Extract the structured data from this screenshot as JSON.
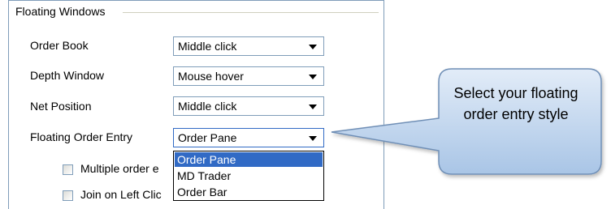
{
  "group": {
    "title": "Floating Windows"
  },
  "rows": [
    {
      "label": "Order Book",
      "value": "Middle click"
    },
    {
      "label": "Depth Window",
      "value": "Mouse hover"
    },
    {
      "label": "Net Position",
      "value": "Middle click"
    },
    {
      "label": "Floating Order Entry",
      "value": "Order Pane"
    }
  ],
  "dropdown": {
    "options": [
      "Order Pane",
      "MD Trader",
      "Order Bar"
    ],
    "selected": "Order Pane"
  },
  "checkboxes": [
    {
      "label": "Multiple order e",
      "checked": false
    },
    {
      "label": "Join on Left Clic",
      "checked": false
    }
  ],
  "callout": {
    "text": "Select your floating order entry style"
  },
  "colors": {
    "highlight": "#316ac5",
    "callout_fill_top": "#dbe8f6",
    "callout_fill_bottom": "#b3cde9",
    "callout_border": "#6f8fb6"
  }
}
